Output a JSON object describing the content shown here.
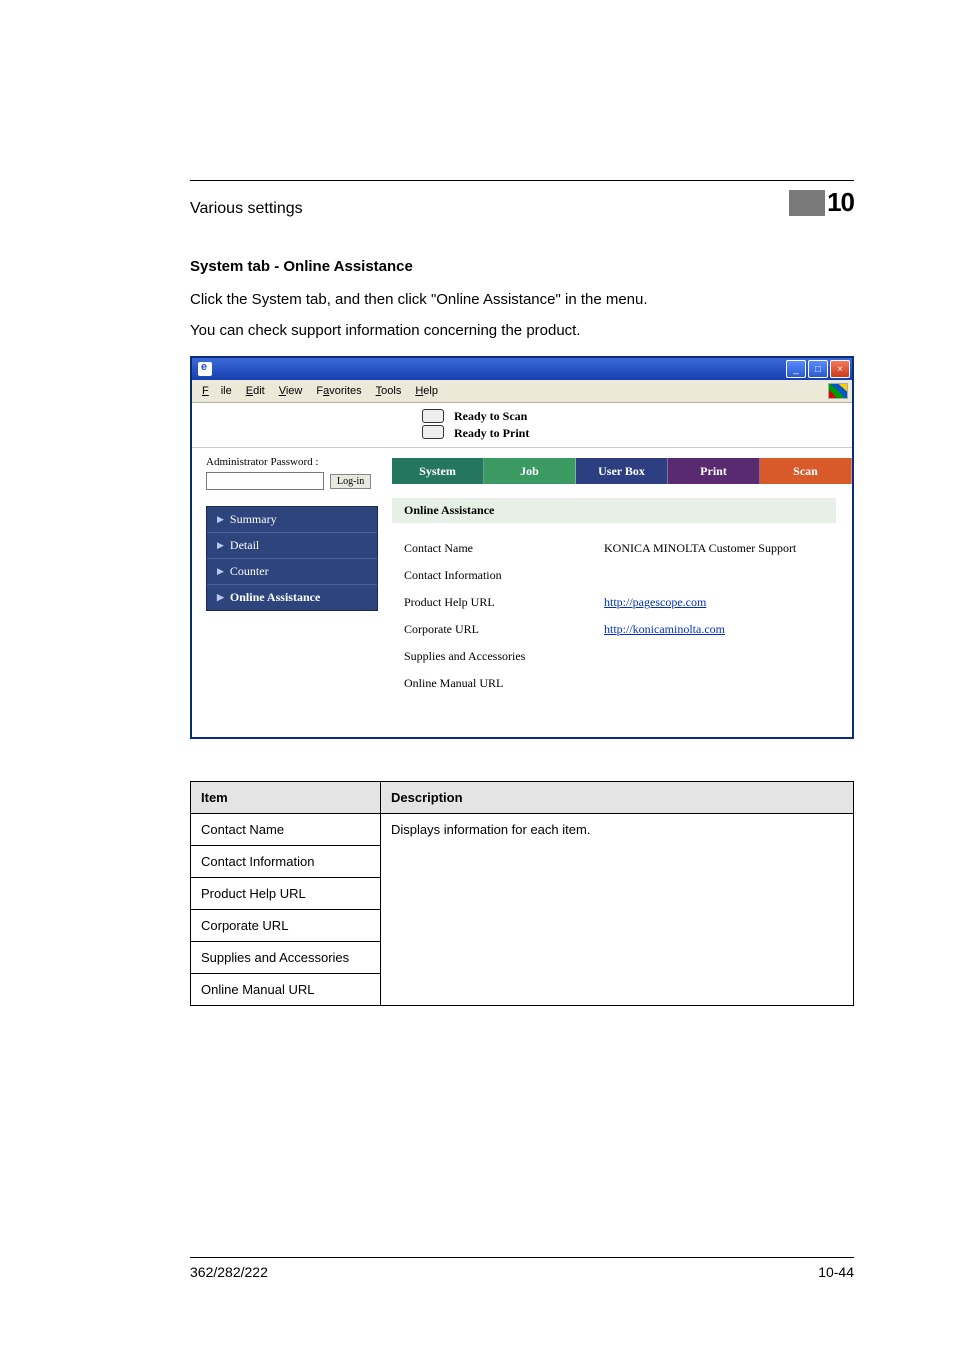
{
  "header": {
    "section_title": "Various settings",
    "chapter_number": "10"
  },
  "heading": "System tab - Online Assistance",
  "paragraphs": {
    "p1": "Click the System tab, and then click \"Online Assistance\" in the menu.",
    "p2": "You can check support information concerning the product."
  },
  "browser": {
    "menus": {
      "file": "File",
      "edit": "Edit",
      "view": "View",
      "favorites": "Favorites",
      "tools": "Tools",
      "help": "Help"
    },
    "status": {
      "scan": "Ready to Scan",
      "print": "Ready to Print"
    },
    "admin": {
      "label": "Administrator Password :",
      "login": "Log-in",
      "value": ""
    },
    "side": {
      "summary": "Summary",
      "detail": "Detail",
      "counter": "Counter",
      "online": "Online Assistance"
    },
    "tabs": {
      "system": "System",
      "job": "Job",
      "userbox": "User Box",
      "print": "Print",
      "scan": "Scan"
    },
    "panel": {
      "title": "Online Assistance",
      "rows": {
        "contact_name": {
          "k": "Contact Name",
          "v": "KONICA MINOLTA Customer Support"
        },
        "contact_info": {
          "k": "Contact Information",
          "v": ""
        },
        "help_url": {
          "k": "Product Help URL",
          "v": "http://pagescope.com"
        },
        "corp_url": {
          "k": "Corporate URL",
          "v": "http://konicaminolta.com"
        },
        "supplies": {
          "k": "Supplies and Accessories",
          "v": ""
        },
        "manual": {
          "k": "Online Manual URL",
          "v": ""
        }
      }
    }
  },
  "table": {
    "head": {
      "item": "Item",
      "desc": "Description"
    },
    "desc_text": "Displays information for each item.",
    "rows": {
      "r1": "Contact Name",
      "r2": "Contact Information",
      "r3": "Product Help URL",
      "r4": "Corporate URL",
      "r5": "Supplies and Accessories",
      "r6": "Online Manual URL"
    }
  },
  "footer": {
    "left": "362/282/222",
    "right": "10-44"
  }
}
